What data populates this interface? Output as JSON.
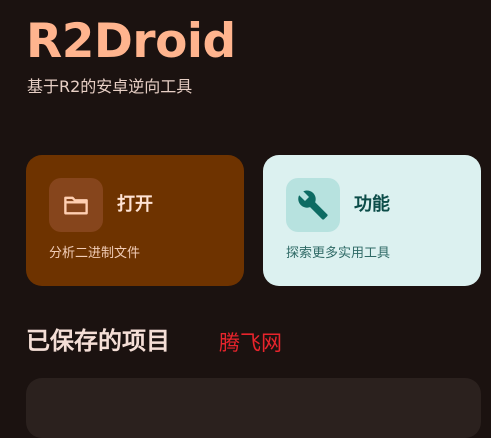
{
  "header": {
    "title": "R2Droid",
    "subtitle": "基于R2的安卓逆向工具"
  },
  "cards": {
    "open": {
      "title": "打开",
      "description": "分析二进制文件",
      "icon": "folder-icon",
      "color": "#6e3300"
    },
    "tools": {
      "title": "功能",
      "description": "探索更多实用工具",
      "icon": "wrench-icon",
      "color": "#dcf1f0"
    }
  },
  "saved": {
    "title": "已保存的项目"
  },
  "watermark": "腾飞网",
  "colors": {
    "background": "#1b1210",
    "accent": "#ffb48e"
  }
}
